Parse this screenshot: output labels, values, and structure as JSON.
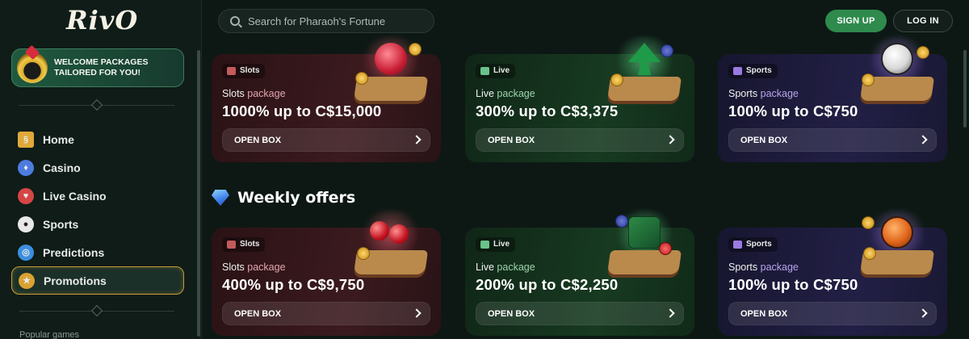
{
  "brand": {
    "logo": "RivO"
  },
  "sidebar": {
    "promo_banner": "WELCOME PACKAGES TAILORED FOR YOU!",
    "items": [
      {
        "label": "Home",
        "icon": "scroll-icon",
        "color": "#e0a83a"
      },
      {
        "label": "Casino",
        "icon": "casino-icon",
        "color": "#4d7be0"
      },
      {
        "label": "Live Casino",
        "icon": "live-casino-icon",
        "color": "#d64545"
      },
      {
        "label": "Sports",
        "icon": "soccer-ball-icon",
        "color": "#e8e8e8"
      },
      {
        "label": "Predictions",
        "icon": "crystal-ball-icon",
        "color": "#3c8ee0"
      },
      {
        "label": "Promotions",
        "icon": "promotions-icon",
        "color": "#d9a233",
        "active": true
      }
    ],
    "section_label": "Popular games"
  },
  "header": {
    "search_placeholder": "Search for Pharaoh's Fortune",
    "signup_label": "SIGN UP",
    "login_label": "LOG IN"
  },
  "welcome_cards": [
    {
      "type": "slots",
      "chip": "Slots",
      "package_prefix": "Slots",
      "package_word": "package",
      "amount": "1000% up to C$15,000",
      "button": "OPEN BOX",
      "item": "ruby-gem-icon"
    },
    {
      "type": "live",
      "chip": "Live",
      "package_prefix": "Live",
      "package_word": "package",
      "amount": "300% up to C$3,375",
      "button": "OPEN BOX",
      "item": "spade-card-icon"
    },
    {
      "type": "sports",
      "chip": "Sports",
      "package_prefix": "Sports",
      "package_word": "package",
      "amount": "100% up to C$750",
      "button": "OPEN BOX",
      "item": "soccer-ball-icon"
    }
  ],
  "weekly": {
    "title": "Weekly offers",
    "cards": [
      {
        "type": "slots",
        "chip": "Slots",
        "package_prefix": "Slots",
        "package_word": "package",
        "amount": "400% up to C$9,750",
        "button": "OPEN BOX",
        "item": "cherries-icon"
      },
      {
        "type": "live",
        "chip": "Live",
        "package_prefix": "Live",
        "package_word": "package",
        "amount": "200% up to C$2,250",
        "button": "OPEN BOX",
        "item": "dice-icon"
      },
      {
        "type": "sports",
        "chip": "Sports",
        "package_prefix": "Sports",
        "package_word": "package",
        "amount": "100% up to C$750",
        "button": "OPEN BOX",
        "item": "basketball-icon"
      }
    ]
  },
  "colors": {
    "accent_green": "#2f8a4d",
    "active_border": "#c79b3a",
    "background": "#0d1814"
  }
}
